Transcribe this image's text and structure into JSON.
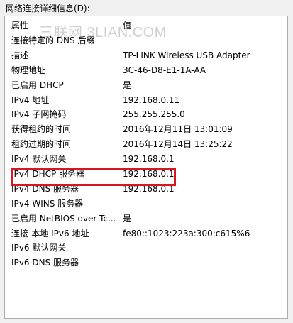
{
  "section_label": "网络连接详细信息(D):",
  "watermark": "三联网 3LIAN.COM",
  "columns": {
    "property": "属性",
    "value": "值"
  },
  "rows": [
    {
      "property": "连接特定的 DNS 后缀",
      "value": ""
    },
    {
      "property": "描述",
      "value": "TP-LINK Wireless USB Adapter"
    },
    {
      "property": "物理地址",
      "value": "3C-46-D8-E1-1A-AA"
    },
    {
      "property": "已启用 DHCP",
      "value": "是"
    },
    {
      "property": "IPv4 地址",
      "value": "192.168.0.11"
    },
    {
      "property": "IPv4 子网掩码",
      "value": "255.255.255.0"
    },
    {
      "property": "获得租约的时间",
      "value": "2016年12月11日 13:01:09"
    },
    {
      "property": "租约过期的时间",
      "value": "2016年12月14日 13:25:22"
    },
    {
      "property": "IPv4 默认网关",
      "value": "192.168.0.1"
    },
    {
      "property": "IPv4 DHCP 服务器",
      "value": "192.168.0.1"
    },
    {
      "property": "IPv4 DNS 服务器",
      "value": "192.168.0.1"
    },
    {
      "property": "IPv4 WINS 服务器",
      "value": ""
    },
    {
      "property": "已启用 NetBIOS over Tc...",
      "value": "是"
    },
    {
      "property": "连接-本地 IPv6 地址",
      "value": "fe80::1023:223a:300:c615%6"
    },
    {
      "property": "IPv6 默认网关",
      "value": ""
    },
    {
      "property": "IPv6 DNS 服务器",
      "value": ""
    }
  ],
  "colors": {
    "highlight": "#d6171f",
    "panel_border": "#adadad",
    "window_bg": "#f0f0f0"
  }
}
